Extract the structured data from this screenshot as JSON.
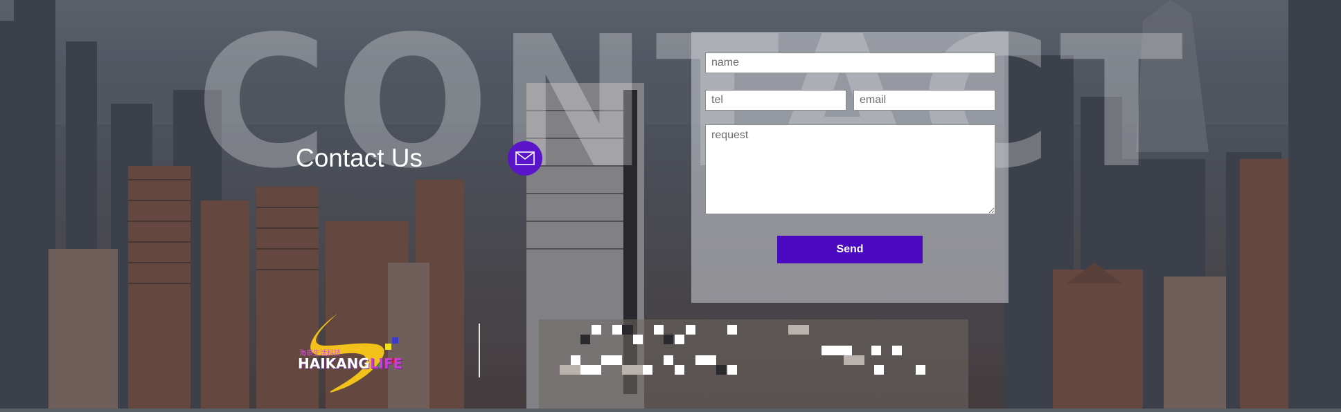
{
  "watermark": "CONTACT",
  "contact": {
    "title": "Contact Us",
    "mail_icon": "envelope-icon"
  },
  "form": {
    "name_placeholder": "name",
    "tel_placeholder": "tel",
    "email_placeholder": "email",
    "request_placeholder": "request",
    "send_label": "Send"
  },
  "footer": {
    "logo_main": "HAIKANG",
    "logo_accent": "LIFE",
    "logo_cn": "海康生活科技"
  },
  "colors": {
    "accent": "#4b0ac0",
    "mail_circle": "#5a14c9",
    "logo_yellow": "#f2c21a",
    "logo_purple": "#c93fd0"
  }
}
